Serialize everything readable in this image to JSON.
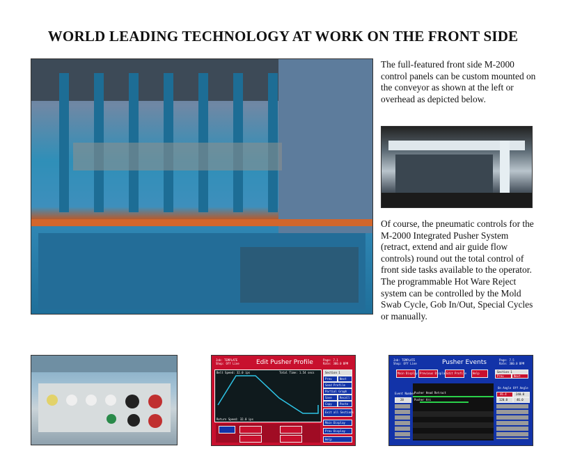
{
  "heading": "WORLD LEADING TECHNOLOGY AT WORK ON THE FRONT SIDE",
  "paragraph_1": "The full-featured front side M-2000 control panels can be custom mounted on the conveyor as shown at the left or overhead as depicted below.",
  "paragraph_2": "Of course, the pneumatic controls for the M-2000 Integrated Pusher System (retract, extend and air guide flow controls) round out the total control of front side tasks available to the operator.  The programmable Hot Ware Reject system can be controlled by the Mold Swab Cycle, Gob In/Out, Special Cycles or manually.",
  "screen_pusher_profile": {
    "title": "Edit Pusher Profile",
    "job": "Job: TEMPLATE",
    "shop": "Shop: Off Line",
    "page": "Page: 7.1",
    "rate": "Rate: 300.0 BPM",
    "belt_speed": "Belt Speed: 32.0 ips",
    "total_time": "Total Time: 1.54 secs",
    "return_speed": "Return Speed: 32.0 ips",
    "buttons": [
      "Section 1",
      "Prev",
      "Next",
      "Send Profile",
      "Partial Graph",
      "Save",
      "Recall",
      "Copy",
      "Paste",
      "Exit all Sections",
      "Main Display",
      "Prev Display",
      "Help"
    ]
  },
  "screen_pusher_events": {
    "title": "Pusher Events",
    "job": "Job: TEMPLATE",
    "shop": "Shop: Off Line",
    "page": "Page: 7.5",
    "rate": "Rate: 300.0 BPM",
    "buttons": [
      "Main Display",
      "Previous Display",
      "Edit Profile",
      "Help",
      "Section 1",
      "Prev",
      "Next"
    ],
    "labels": [
      "Event Number",
      "Pusher Head Retract",
      "Pusher Arc",
      "On Angle",
      "Off Angle"
    ],
    "values": [
      "28",
      "46.4",
      "240.0",
      "120.0",
      "46.0"
    ]
  },
  "colors": {
    "heading_text": "#111111",
    "profile_screen_bg": "#c8102e",
    "events_screen_bg": "#1233a8",
    "graph_line": "#2ec4e6"
  }
}
